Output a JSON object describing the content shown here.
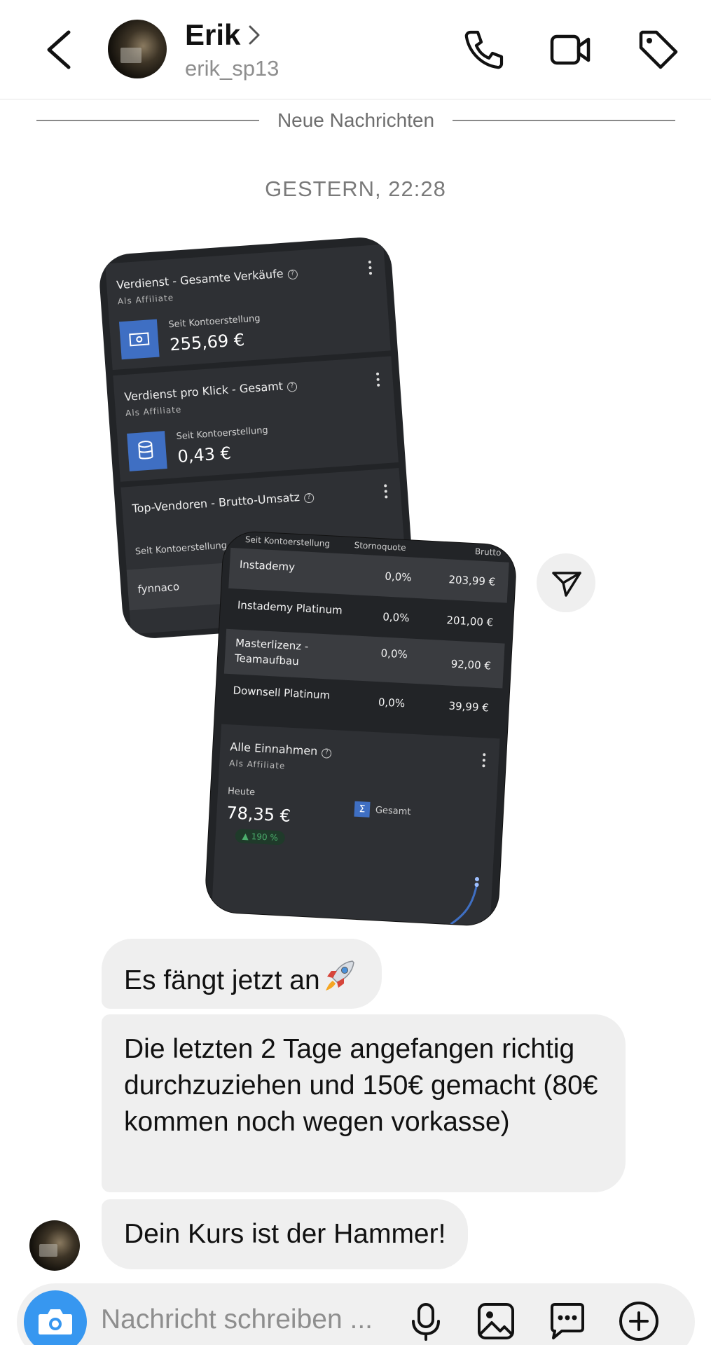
{
  "header": {
    "name": "Erik",
    "handle": "erik_sp13",
    "icons": [
      "back-icon",
      "phone-icon",
      "video-icon",
      "tag-icon"
    ]
  },
  "divider": {
    "label": "Neue Nachrichten"
  },
  "timestamp": "GESTERN, 22:28",
  "shared_image_1": {
    "cards": [
      {
        "title": "Verdienst - Gesamte Verkäufe",
        "subtitle": "Als Affiliate",
        "caption": "Seit Kontoerstellung",
        "value": "255,69 €"
      },
      {
        "title": "Verdienst pro Klick - Gesamt",
        "subtitle": "Als Affiliate",
        "caption": "Seit Kontoerstellung",
        "value": "0,43 €"
      },
      {
        "title": "Top-Vendoren - Brutto-Umsatz",
        "caption": "Seit Kontoerstellung",
        "row": "fynnaco"
      }
    ]
  },
  "shared_image_2": {
    "columns": {
      "period": "Seit Kontoerstellung",
      "storno": "Stornoquote",
      "brutto": "Brutto"
    },
    "rows": [
      {
        "name": "Instademy",
        "storno": "0,0%",
        "brutto": "203,99 €"
      },
      {
        "name": "Instademy Platinum",
        "storno": "0,0%",
        "brutto": "201,00 €"
      },
      {
        "name": "Masterlizenz - Teamaufbau",
        "storno": "0,0%",
        "brutto": "92,00 €"
      },
      {
        "name": "Downsell Platinum",
        "storno": "0,0%",
        "brutto": "39,99 €"
      }
    ],
    "earnings_card": {
      "title": "Alle Einnahmen",
      "subtitle": "Als Affiliate",
      "period": "Heute",
      "value": "78,35 €",
      "change": "▲ 190 %",
      "legend": "Gesamt"
    }
  },
  "messages": [
    {
      "text": "Es fängt jetzt an"
    },
    {
      "text": "Die letzten 2 Tage angefangen richtig durchzuziehen und 150€ gemacht (80€ kommen noch wegen vorkasse)"
    },
    {
      "text": "Dein Kurs ist der Hammer!"
    }
  ],
  "composer": {
    "placeholder": "Nachricht schreiben ...",
    "icons": [
      "camera-icon",
      "microphone-icon",
      "gallery-icon",
      "sticker-icon",
      "plus-icon"
    ],
    "accent": "#3797f0"
  }
}
